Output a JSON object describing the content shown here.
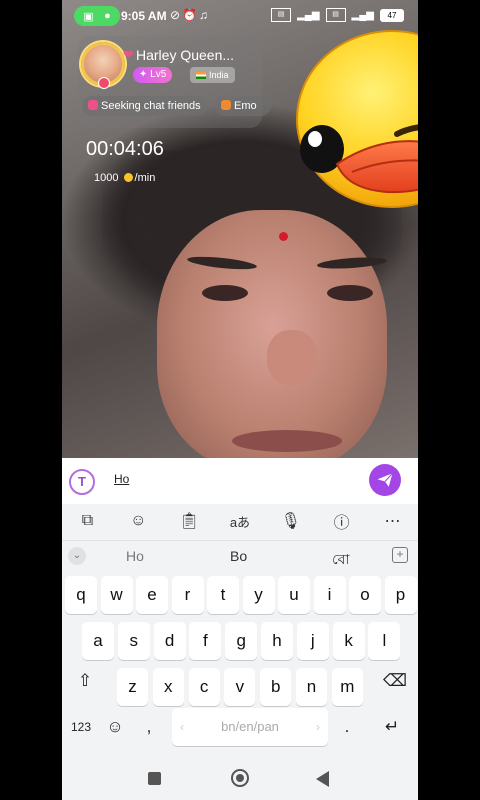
{
  "status_bar": {
    "time": "9:05 AM",
    "battery": "47"
  },
  "profile": {
    "name": "Harley Queen...",
    "level": "Lv5",
    "country": "India",
    "tags": [
      "Seeking chat friends",
      "Emo"
    ]
  },
  "call": {
    "timer": "00:04:06",
    "rate_amount": "1000",
    "rate_unit": "/min"
  },
  "input": {
    "text": "Ho"
  },
  "suggestions": [
    "Ho",
    "Bo",
    "বো"
  ],
  "keyboard": {
    "row1": [
      "q",
      "w",
      "e",
      "r",
      "t",
      "y",
      "u",
      "i",
      "o",
      "p"
    ],
    "row2": [
      "a",
      "s",
      "d",
      "f",
      "g",
      "h",
      "j",
      "k",
      "l"
    ],
    "row3": [
      "z",
      "x",
      "c",
      "v",
      "b",
      "n",
      "m"
    ],
    "numbers_key": "123",
    "space_label": "bn/en/pan",
    "comma": ",",
    "period": "."
  },
  "colors": {
    "accent_purple": "#a445e6",
    "status_green": "#4cd964"
  }
}
